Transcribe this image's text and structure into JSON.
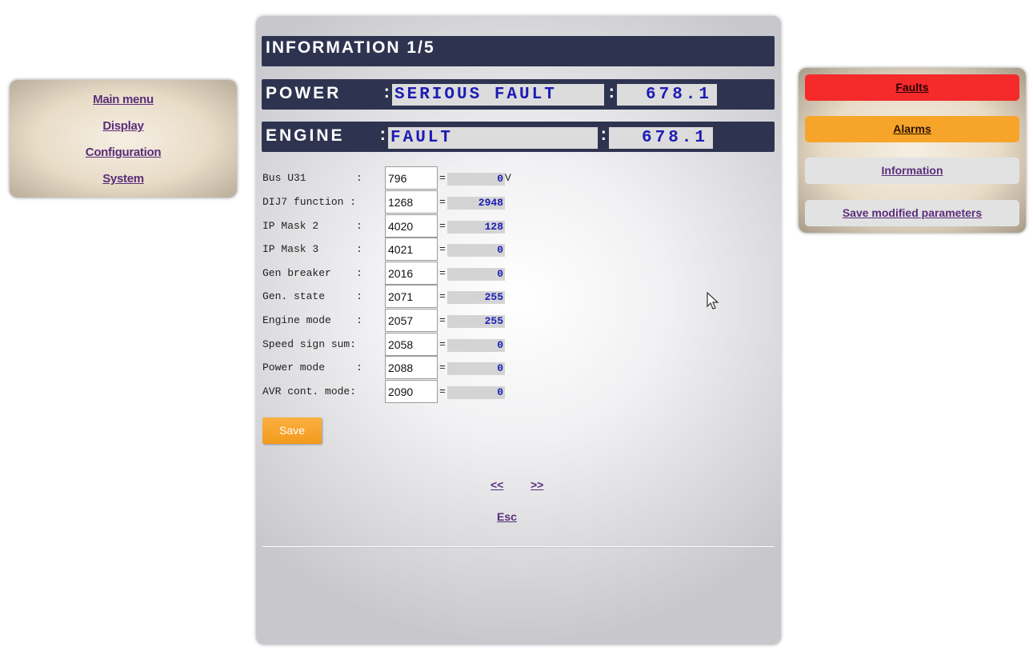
{
  "left_nav": {
    "items": [
      {
        "label": "Main menu"
      },
      {
        "label": "Display"
      },
      {
        "label": "Configuration"
      },
      {
        "label": "System"
      }
    ]
  },
  "header": {
    "title": "INFORMATION 1/5",
    "power": {
      "label": "POWER",
      "colon": ":",
      "state": "SERIOUS FAULT",
      "sep": ":",
      "value": "678.1"
    },
    "engine": {
      "label": "ENGINE",
      "colon": ":",
      "state": "FAULT",
      "sep": ":",
      "value": "678.1"
    }
  },
  "params": [
    {
      "label": "Bus U31        :",
      "input": "796",
      "eq": "=",
      "value": "0",
      "unit": "V"
    },
    {
      "label": "DIJ7 function :",
      "input": "1268",
      "eq": "=",
      "value": "2948",
      "unit": ""
    },
    {
      "label": "IP Mask 2      :",
      "input": "4020",
      "eq": "=",
      "value": "128",
      "unit": ""
    },
    {
      "label": "IP Mask 3      :",
      "input": "4021",
      "eq": "=",
      "value": "0",
      "unit": ""
    },
    {
      "label": "Gen breaker    :",
      "input": "2016",
      "eq": "=",
      "value": "0",
      "unit": ""
    },
    {
      "label": "Gen. state     :",
      "input": "2071",
      "eq": "=",
      "value": "255",
      "unit": ""
    },
    {
      "label": "Engine mode    :",
      "input": "2057",
      "eq": "=",
      "value": "255",
      "unit": ""
    },
    {
      "label": "Speed sign sum:",
      "input": "2058",
      "eq": "=",
      "value": "0",
      "unit": ""
    },
    {
      "label": "Power mode     :",
      "input": "2088",
      "eq": "=",
      "value": "0",
      "unit": ""
    },
    {
      "label": "AVR cont. mode:",
      "input": "2090",
      "eq": "=",
      "value": "0",
      "unit": ""
    }
  ],
  "actions": {
    "save_label": "Save",
    "prev_label": "<<",
    "next_label": ">>",
    "esc_label": "Esc"
  },
  "right_nav": {
    "faults": {
      "label": "Faults",
      "color": "#f52a2a"
    },
    "alarms": {
      "label": "Alarms",
      "color": "#f7a52a"
    },
    "information": {
      "label": "Information",
      "color": "#e2e2e2"
    },
    "save_params": {
      "label": "Save modified parameters",
      "color": "#e2e2e2"
    }
  },
  "colors": {
    "header_bar": "#2e3450",
    "value_text": "#1c1cb4",
    "link": "#5b2d7a",
    "save_button": "#f7a52a"
  }
}
